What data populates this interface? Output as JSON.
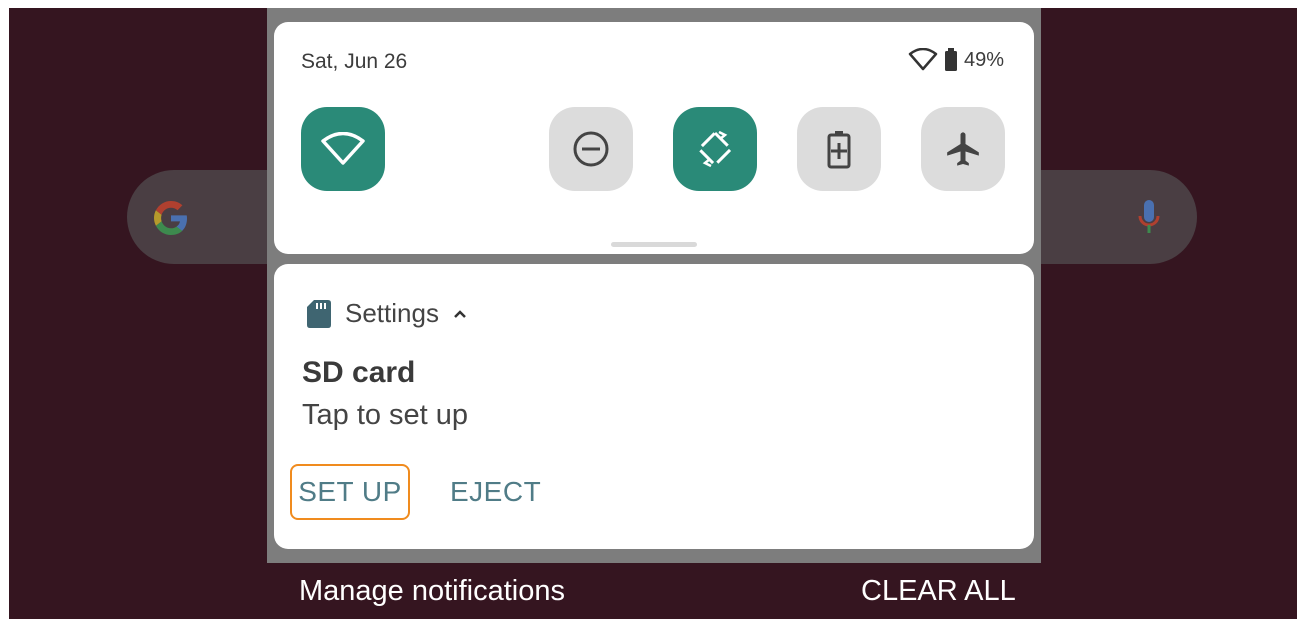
{
  "quick_settings": {
    "date": "Sat, Jun 26",
    "battery_percent": "49%",
    "tiles": [
      {
        "name": "wifi",
        "state": "on",
        "icon": "wifi-icon"
      },
      {
        "name": "do-not-disturb",
        "state": "off",
        "icon": "do-not-disturb-icon"
      },
      {
        "name": "auto-rotate",
        "state": "on",
        "icon": "auto-rotate-icon"
      },
      {
        "name": "battery-saver",
        "state": "off",
        "icon": "battery-saver-icon"
      },
      {
        "name": "airplane-mode",
        "state": "off",
        "icon": "airplane-icon"
      }
    ]
  },
  "notification": {
    "app_name": "Settings",
    "app_icon": "sd-card-icon",
    "title": "SD card",
    "text": "Tap to set up",
    "actions": {
      "setup": "SET UP",
      "eject": "EJECT"
    }
  },
  "footer": {
    "manage": "Manage notifications",
    "clear_all": "CLEAR ALL"
  },
  "colors": {
    "accent": "#2a8a78",
    "wallpaper": "#351520",
    "action_text": "#507c87",
    "focus_outline": "#f08b1e"
  }
}
